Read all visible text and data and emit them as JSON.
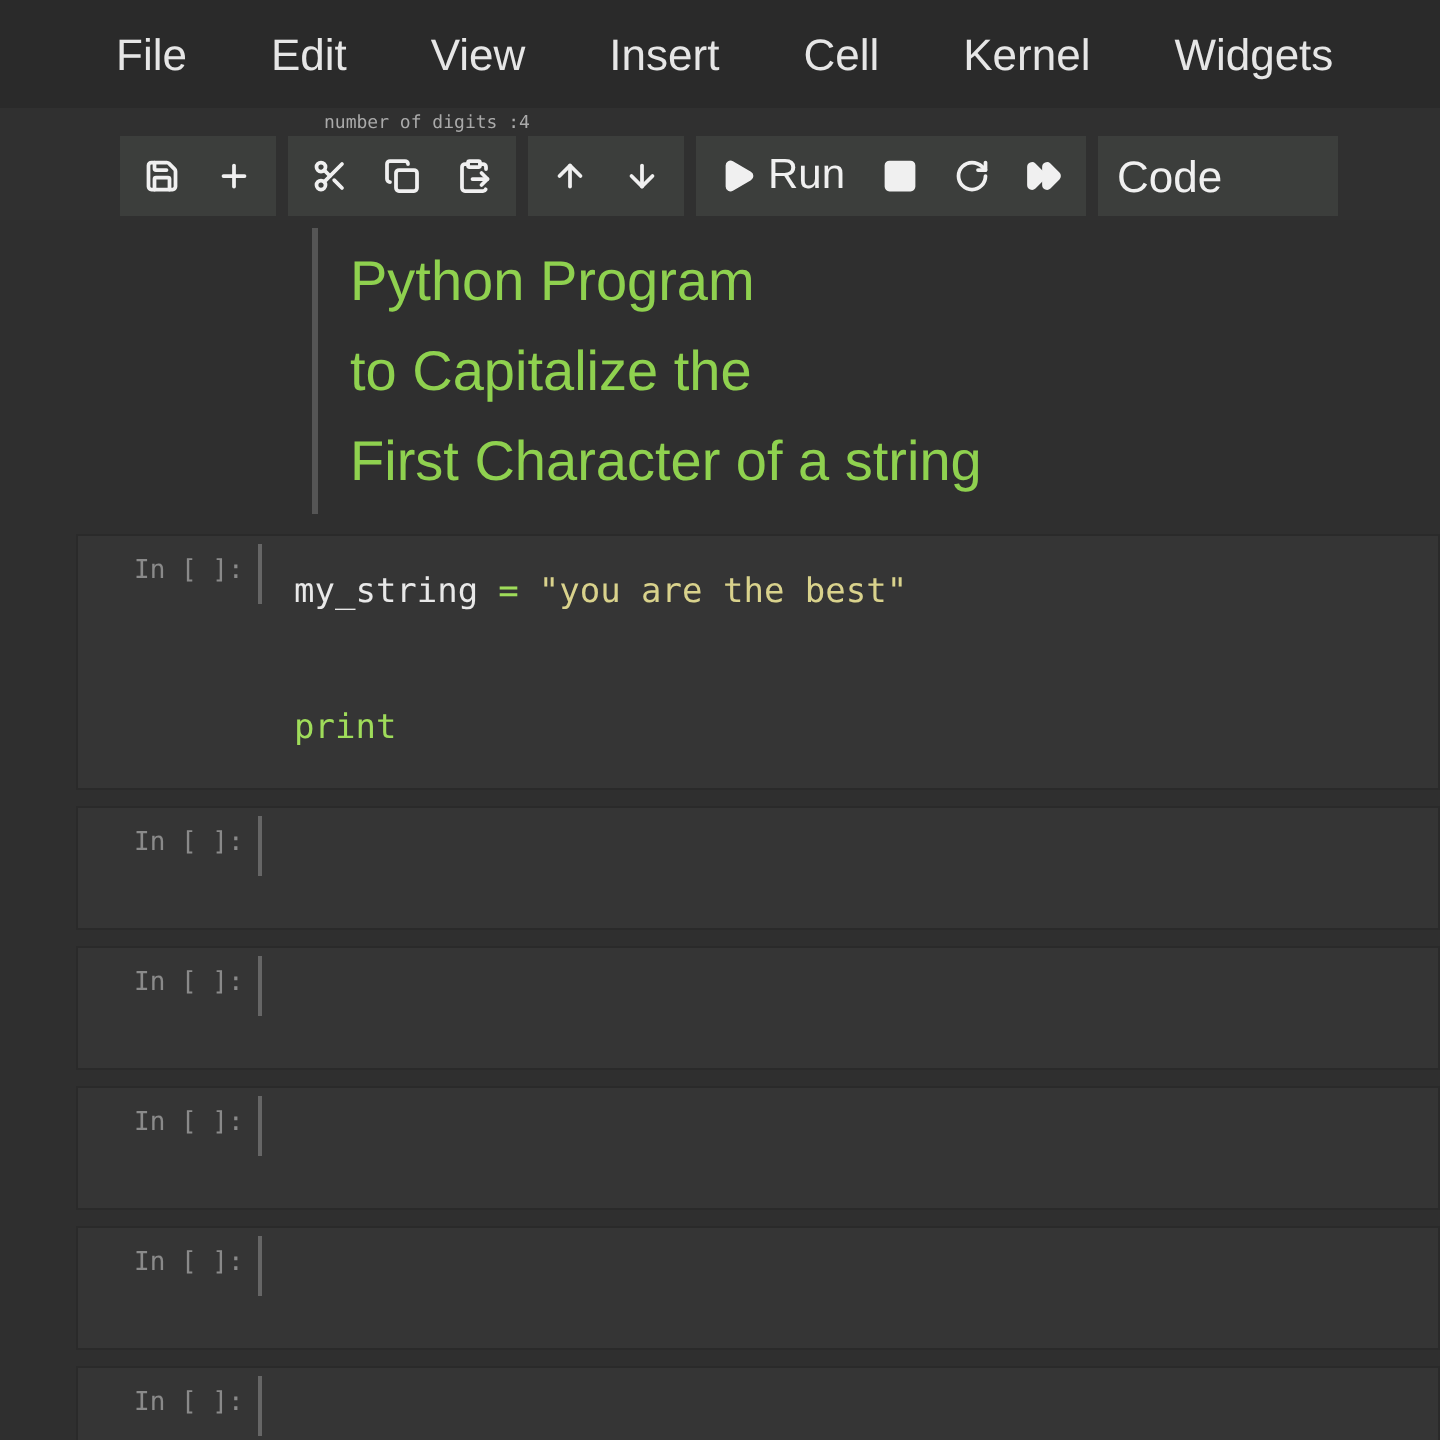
{
  "menu": [
    "File",
    "Edit",
    "View",
    "Insert",
    "Cell",
    "Kernel",
    "Widgets"
  ],
  "previous_output": "number of digits :4",
  "toolbar": {
    "groups": [
      [
        {
          "kind": "save"
        },
        {
          "kind": "add"
        }
      ],
      [
        {
          "kind": "cut"
        },
        {
          "kind": "copy"
        },
        {
          "kind": "paste"
        }
      ],
      [
        {
          "kind": "up"
        },
        {
          "kind": "down"
        }
      ],
      [
        {
          "kind": "run",
          "label": "Run"
        },
        {
          "kind": "stop"
        },
        {
          "kind": "restart"
        },
        {
          "kind": "fast-forward"
        }
      ]
    ],
    "cell_type": "Code"
  },
  "markdown_cell": {
    "lines": [
      "Python Program",
      "to Capitalize the",
      "First Character of a string"
    ]
  },
  "code_cells": [
    {
      "prompt": "In [ ]:",
      "lines": [
        [
          {
            "kind": "name",
            "text": "my_string"
          },
          {
            "kind": "op",
            "text": "="
          },
          {
            "kind": "string",
            "text": "\"you are the best\""
          }
        ],
        [
          {
            "kind": "builtin",
            "text": "print"
          }
        ]
      ]
    },
    {
      "prompt": "In [ ]:"
    },
    {
      "prompt": "In [ ]:"
    },
    {
      "prompt": "In [ ]:"
    },
    {
      "prompt": "In [ ]:"
    },
    {
      "prompt": "In [ ]:"
    }
  ]
}
